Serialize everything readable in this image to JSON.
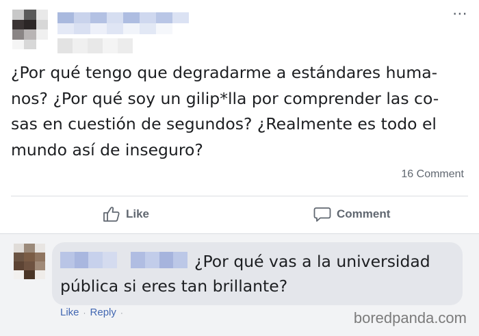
{
  "post": {
    "text_lines": [
      "¿Por qué tengo que degradarme a estándares huma-",
      "nos? ¿Por qué soy un gilip*lla por comprender las co-",
      "sas en cuestión de segundos? ¿Realmente es todo el",
      "mundo así de inseguro?"
    ],
    "more_icon": "⋯",
    "comment_count": "16 Comment"
  },
  "actions": {
    "like_label": "Like",
    "comment_label": "Comment",
    "like_icon": "thumbs-up-icon",
    "comment_icon": "speech-bubble-icon"
  },
  "comment": {
    "text_line1": "¿Por qué vas a la universidad",
    "text_line2": "pública si eres tan brillante?",
    "like_link": "Like",
    "separator": "·",
    "reply_link": "Reply"
  },
  "watermark": "boredpanda.com",
  "colors": {
    "text": "#1c1e21",
    "muted": "#606770",
    "link": "#4267b2",
    "bubble": "#e4e6eb"
  }
}
